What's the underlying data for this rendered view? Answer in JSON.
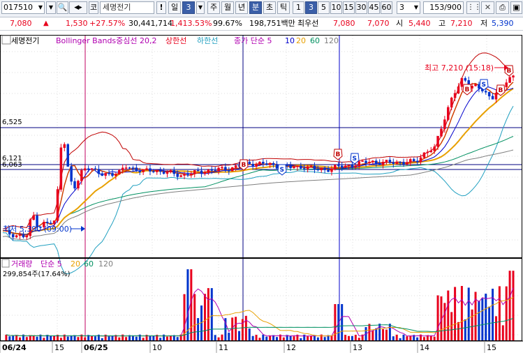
{
  "toolbar": {
    "code": "017510",
    "market_prefix": "코",
    "stock_name": "세명전기",
    "alert_label": "!",
    "period_unit": "일",
    "period_count": "3",
    "tab_week": "주",
    "tab_month": "월",
    "tab_year": "년",
    "tab_minute": "분",
    "tab_second": "초",
    "tab_tick": "틱",
    "minute_options": [
      "1",
      "3",
      "5",
      "10",
      "15",
      "30",
      "45",
      "60"
    ],
    "minute_selected": "3",
    "count_value": "3",
    "page_counter": "153",
    "page_total": "/900"
  },
  "colors": {
    "up": "#e8001c",
    "down": "#0033cc",
    "bollinger": "#c00000",
    "bollinger_lower": "#21a0c0",
    "ma5": "#d04000",
    "ma10": "#0000cc",
    "ma20": "#e8a000",
    "ma60": "#009060",
    "ma120": "#7f7f7f"
  },
  "infobar": {
    "price": "7,080",
    "arrow": "▲",
    "change": "1,530",
    "change_pct": "+27.57%",
    "volume": "30,441,714",
    "volume_ratio": "1,413.53%",
    "strength": "99.67%",
    "trade_amount": "198,751백만",
    "ask_label": "최우선",
    "ask": "7,080",
    "bid": "7,070",
    "open_label": "시",
    "open": "5,440",
    "high_label": "고",
    "high": "7,210",
    "low_label": "저",
    "low": "5,390"
  },
  "price_panel": {
    "name_tag": "세명전기",
    "legend": [
      {
        "text": "Bollinger Bands중심선 20,2",
        "color": "#b000b0"
      },
      {
        "text": "상한선",
        "color": "#e8001c"
      },
      {
        "text": "하한선",
        "color": "#21a0c0"
      },
      {
        "text": "종가 단순 5",
        "color": "#b000b0"
      },
      {
        "text": "10",
        "color": "#0000cc"
      },
      {
        "text": "20",
        "color": "#e8a000"
      },
      {
        "text": "60",
        "color": "#009060"
      },
      {
        "text": "120",
        "color": "#7f7f7f"
      }
    ],
    "level_labels": [
      "6,525",
      "6,121",
      "6,063"
    ],
    "high_annotation": "최고 7,210 (15:18)",
    "low_annotation": "최저 5,390 (09:00)"
  },
  "volume_panel": {
    "legend": [
      {
        "text": "거래량",
        "color": "#b000b0"
      },
      {
        "text": "단순 5",
        "color": "#b000b0"
      },
      {
        "text": "20",
        "color": "#e8a000"
      },
      {
        "text": "60",
        "color": "#009060"
      },
      {
        "text": "120",
        "color": "#7f7f7f"
      }
    ],
    "current": "299,854주(17.64%)"
  },
  "time_axis": [
    "06/24",
    "15",
    "06/25",
    "10",
    "11",
    "12",
    "13",
    "14",
    "15"
  ],
  "chart_data": {
    "type": "candlestick",
    "price_range": [
      5390,
      7210
    ],
    "horizontal_levels": [
      6525,
      6121,
      6063
    ],
    "signals": [
      "B",
      "S"
    ]
  }
}
